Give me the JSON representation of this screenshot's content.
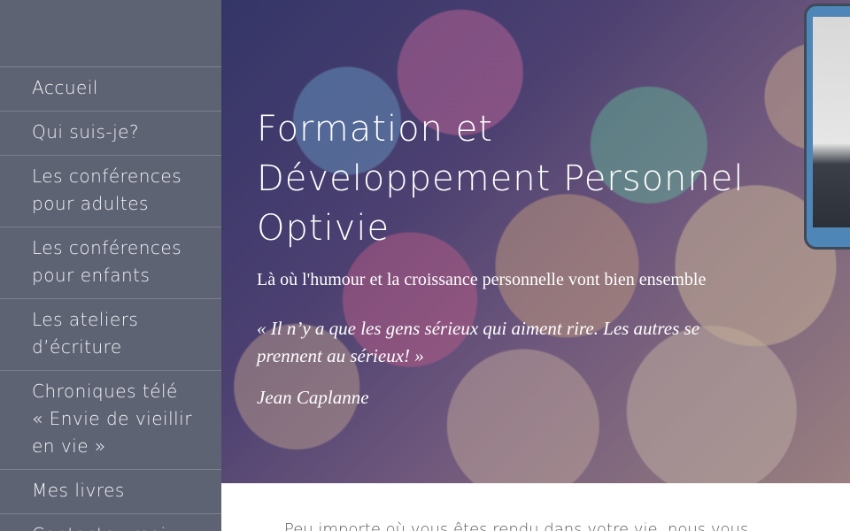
{
  "sidebar": {
    "items": [
      {
        "label": "Accueil"
      },
      {
        "label": "Qui suis-je?"
      },
      {
        "label": "Les conférences pour adultes"
      },
      {
        "label": "Les conférences pour enfants"
      },
      {
        "label": "Les ateliers d’écriture"
      },
      {
        "label": "Chroniques télé « Envie de vieillir en vie »"
      },
      {
        "label": "Mes livres"
      },
      {
        "label": "Contactez-moi"
      }
    ]
  },
  "hero": {
    "title": "Formation et Développement Personnel Optivie",
    "subtitle": "Là où l'humour et la croissance personnelle vont bien ensemble",
    "quote": "« Il n’y a que les gens sérieux qui aiment rire. Les autres se prennent au sérieux! »",
    "author": "Jean Caplanne"
  },
  "main": {
    "intro_partial": "Peu importe où vous êtes rendu dans votre vie, nous vous"
  }
}
